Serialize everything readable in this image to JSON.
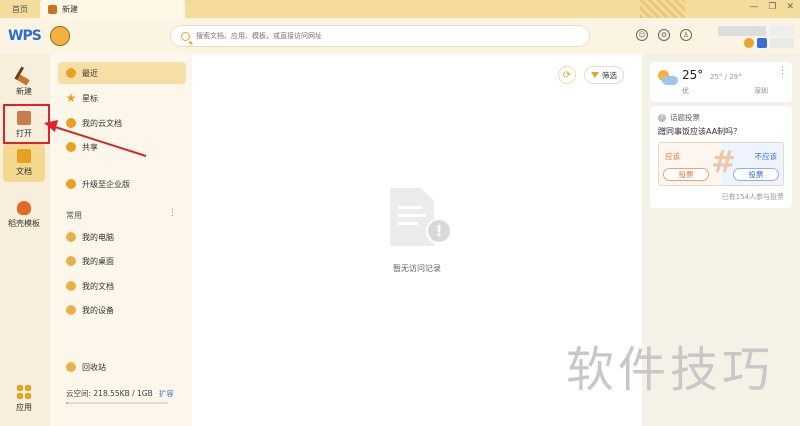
{
  "titlebar": {
    "tabs": [
      {
        "label": "首页"
      },
      {
        "label": "新建"
      }
    ]
  },
  "header": {
    "logo_text": "WPS",
    "search": {
      "placeholder": "搜索文档、应用、模板，或直接访问网址",
      "value": ""
    }
  },
  "rail": {
    "items": [
      {
        "label": "新建",
        "icon": "broom-icon"
      },
      {
        "label": "打开",
        "icon": "folder-icon"
      },
      {
        "label": "文档",
        "icon": "document-icon"
      },
      {
        "label": "稻壳模板",
        "icon": "shell-icon"
      },
      {
        "label": "应用",
        "icon": "apps-icon"
      }
    ]
  },
  "sidebar": {
    "items": [
      {
        "label": "最近",
        "icon": "clock-icon"
      },
      {
        "label": "星标",
        "icon": "star-icon"
      },
      {
        "label": "我的云文档",
        "icon": "cloud-icon"
      },
      {
        "label": "共享",
        "icon": "share-icon"
      },
      {
        "label": "升级至企业版",
        "icon": "upgrade-icon"
      }
    ],
    "section_title": "常用",
    "common": [
      {
        "label": "我的电脑"
      },
      {
        "label": "我的桌面"
      },
      {
        "label": "我的文档"
      },
      {
        "label": "我的设备"
      }
    ],
    "trash_label": "回收站",
    "storage_label": "云空间: 218.55KB / 1GB",
    "storage_expand": "扩容",
    "storage_fraction": 0.02
  },
  "main": {
    "filter_label": "筛选",
    "empty_text": "暂无访问记录"
  },
  "weather": {
    "temp": "25°",
    "range": "25° / 29°",
    "quality": "优",
    "city": "深圳"
  },
  "vote": {
    "header": "话题投票",
    "question": "蹭同事饭应该AA制吗？",
    "left_option": "应该",
    "right_option": "不应该",
    "vote_button": "投票",
    "count": "已有154人参与投票"
  },
  "watermark": "软件技巧",
  "colors": {
    "accent": "#e9a123",
    "highlight": "#d9242a"
  }
}
